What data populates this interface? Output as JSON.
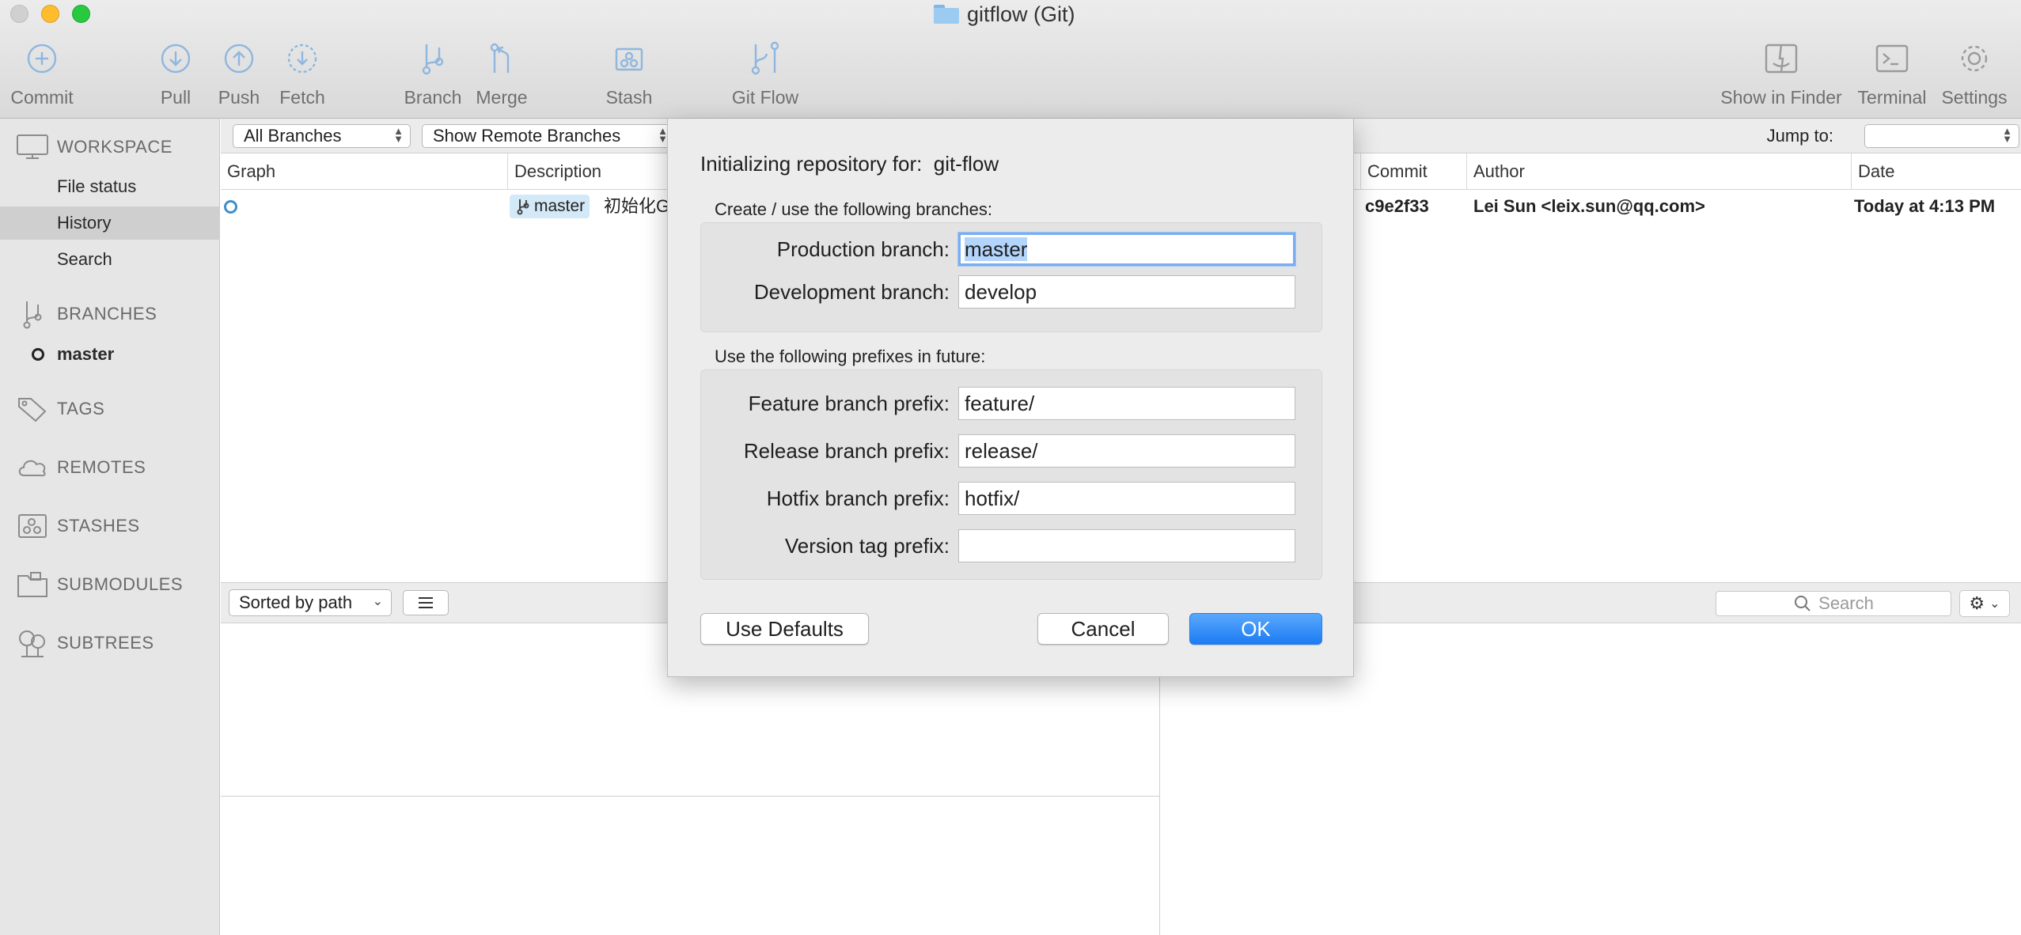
{
  "window": {
    "title": "gitflow (Git)"
  },
  "toolbar": {
    "commit": "Commit",
    "pull": "Pull",
    "push": "Push",
    "fetch": "Fetch",
    "branch": "Branch",
    "merge": "Merge",
    "stash": "Stash",
    "gitflow": "Git Flow",
    "show_in_finder": "Show in Finder",
    "terminal": "Terminal",
    "settings": "Settings"
  },
  "sidebar": {
    "workspace": "WORKSPACE",
    "items": [
      "File status",
      "History",
      "Search"
    ],
    "branches": "BRANCHES",
    "branch_items": [
      "master"
    ],
    "tags": "TAGS",
    "remotes": "REMOTES",
    "stashes": "STASHES",
    "submodules": "SUBMODULES",
    "subtrees": "SUBTREES"
  },
  "filters": {
    "branches": "All Branches",
    "remote": "Show Remote Branches",
    "jump_to": "Jump to:"
  },
  "columns": {
    "graph": "Graph",
    "description": "Description",
    "commit": "Commit",
    "author": "Author",
    "date": "Date"
  },
  "commits": [
    {
      "branch_tag": "master",
      "description": "初始化G",
      "hash": "c9e2f33",
      "author": "Lei Sun <leix.sun@qq.com>",
      "date": "Today at 4:13 PM"
    }
  ],
  "bottom": {
    "sort": "Sorted by path",
    "search_placeholder": "Search"
  },
  "dialog": {
    "title_prefix": "Initializing repository for:",
    "repo": "git-flow",
    "branches_label": "Create / use the following branches:",
    "production_label": "Production branch:",
    "production_value": "master",
    "development_label": "Development branch:",
    "development_value": "develop",
    "prefixes_label": "Use the following prefixes in future:",
    "feature_label": "Feature branch prefix:",
    "feature_value": "feature/",
    "release_label": "Release branch prefix:",
    "release_value": "release/",
    "hotfix_label": "Hotfix branch prefix:",
    "hotfix_value": "hotfix/",
    "version_label": "Version tag prefix:",
    "version_value": "",
    "use_defaults": "Use Defaults",
    "cancel": "Cancel",
    "ok": "OK"
  },
  "colors": {
    "accent": "#1c7cf4",
    "selection": "#b3d4fc",
    "sidebar": "#e6e6e6"
  }
}
